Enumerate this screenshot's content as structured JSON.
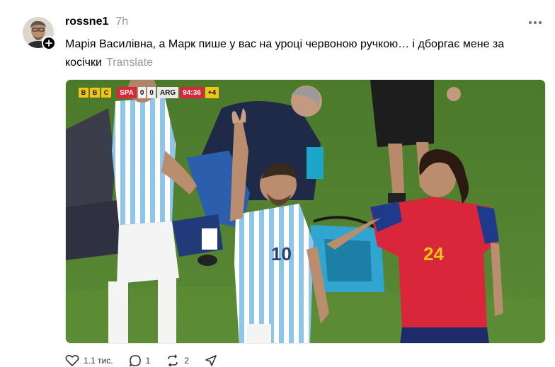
{
  "post": {
    "username": "rossne1",
    "time": "7h",
    "text": "Марія Василівна, а Марк пише у вас на уроці червоною ручкою… і дборгає мене за косічки",
    "translate_label": "Translate"
  },
  "scorebug": {
    "broadcaster": [
      "B",
      "B",
      "C"
    ],
    "team_home": "SPA",
    "score_home": "0",
    "score_away": "0",
    "team_away": "ARG",
    "clock": "94:36",
    "added_time": "+4"
  },
  "actions": {
    "likes": "1.1 тис.",
    "comments": "1",
    "reposts": "2",
    "share": ""
  },
  "icons": {
    "more": "more-horizontal-icon",
    "follow": "plus-icon",
    "like": "heart-icon",
    "comment": "comment-icon",
    "repost": "repost-icon",
    "share": "share-icon"
  },
  "colors": {
    "meta_gray": "#999999",
    "pitch_green": "#4f7d2e",
    "spain_red": "#d9263b",
    "argentina_blue": "#8ec5ea"
  }
}
